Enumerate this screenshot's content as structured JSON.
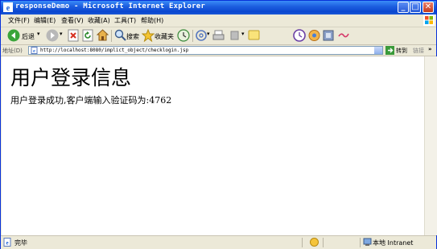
{
  "window": {
    "title": "responseDemo - Microsoft Internet Explorer",
    "minimize_symbol": "_",
    "maximize_symbol": "□",
    "close_symbol": "✕"
  },
  "menu": {
    "items": [
      "文件(F)",
      "编辑(E)",
      "查看(V)",
      "收藏(A)",
      "工具(T)",
      "帮助(H)"
    ]
  },
  "toolbar": {
    "back_label": "后退",
    "search_label": "搜索",
    "favorites_label": "收藏夹"
  },
  "address": {
    "label": "地址(D)",
    "url": "http://localhost:8080/implict_object/checklogin.jsp",
    "go_label": "转到",
    "links_label": "链接"
  },
  "page": {
    "heading": "用户登录信息",
    "message": "用户登录成功,客户端输入验证码为:4762"
  },
  "status": {
    "text": "完毕",
    "zone": "本地 Intranet"
  },
  "colors": {
    "titlebar": "#0a46cf",
    "chrome": "#ece9d8"
  },
  "icons": [
    "ie-logo-icon",
    "back-icon",
    "forward-icon",
    "stop-icon",
    "refresh-icon",
    "home-icon",
    "search-icon",
    "favorites-star-icon",
    "history-icon",
    "mail-icon",
    "print-icon",
    "edit-icon",
    "discuss-icon",
    "messenger-icon",
    "media-icon",
    "research-icon",
    "xp-logo-icon",
    "page-icon",
    "go-icon",
    "zone-icon"
  ]
}
